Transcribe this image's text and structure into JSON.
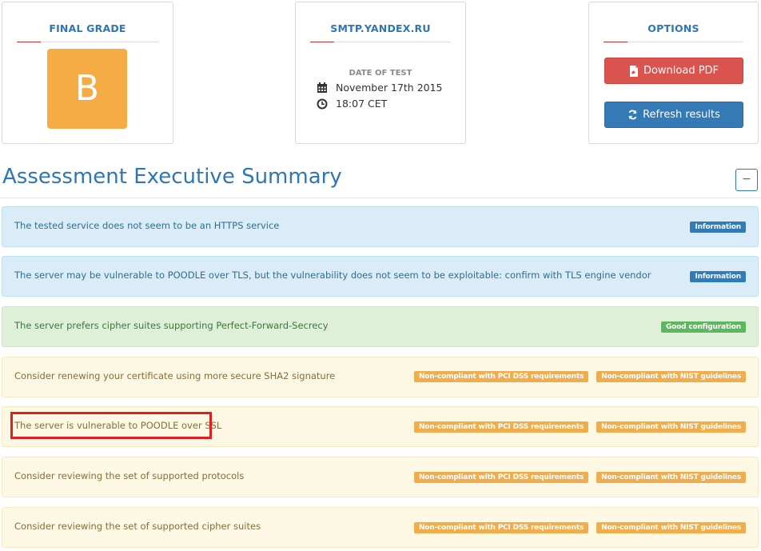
{
  "final_grade": {
    "title": "FINAL GRADE",
    "grade": "B",
    "grade_color": "#f5ac45"
  },
  "server": {
    "title": "SMTP.YANDEX.RU",
    "date_label": "DATE OF TEST",
    "date": "November 17th 2015",
    "time": "18:07 CET"
  },
  "options": {
    "title": "OPTIONS",
    "download_label": "Download PDF",
    "refresh_label": "Refresh results"
  },
  "summary": {
    "heading": "Assessment Executive Summary",
    "collapse_label": "−",
    "items": [
      {
        "text": "The tested service does not seem to be an HTTPS service",
        "type": "info",
        "badges": [
          "Information"
        ]
      },
      {
        "text": "The server may be vulnerable to POODLE over TLS, but the vulnerability does not seem to be exploitable: confirm with TLS engine vendor",
        "type": "info",
        "badges": [
          "Information"
        ]
      },
      {
        "text": "The server prefers cipher suites supporting Perfect-Forward-Secrecy",
        "type": "success",
        "badges": [
          "Good configuration"
        ]
      },
      {
        "text": "Consider renewing your certificate using more secure SHA2 signature",
        "type": "warning",
        "badges": [
          "Non-compliant with PCI DSS requirements",
          "Non-compliant with NIST guidelines"
        ]
      },
      {
        "text": "The server is vulnerable to POODLE over SSL",
        "type": "warning",
        "badges": [
          "Non-compliant with PCI DSS requirements",
          "Non-compliant with NIST guidelines"
        ]
      },
      {
        "text": "Consider reviewing the set of supported protocols",
        "type": "warning",
        "badges": [
          "Non-compliant with PCI DSS requirements",
          "Non-compliant with NIST guidelines"
        ]
      },
      {
        "text": "Consider reviewing the set of supported cipher suites",
        "type": "warning",
        "badges": [
          "Non-compliant with PCI DSS requirements",
          "Non-compliant with NIST guidelines"
        ]
      }
    ]
  },
  "colors": {
    "accent": "#2e76b5",
    "danger": "#d9534f",
    "primary": "#337ab7",
    "warning": "#f0ad4e",
    "success": "#5cb85c"
  }
}
